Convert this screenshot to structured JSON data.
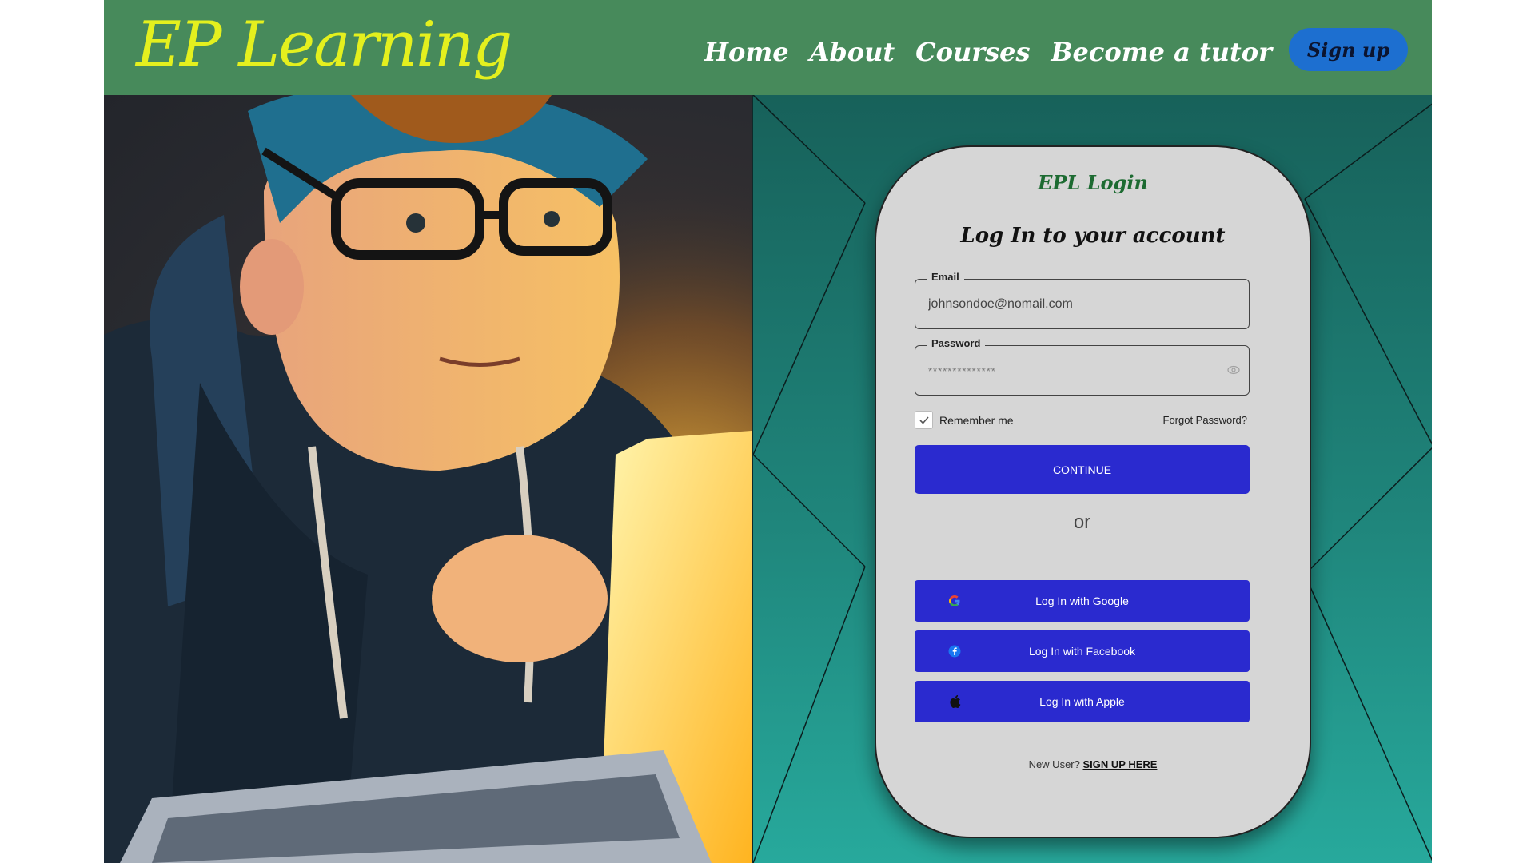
{
  "header": {
    "logo": "EP Learning",
    "nav": [
      "Home",
      "About",
      "Courses",
      "Become a tutor"
    ],
    "signup_label": "Sign up"
  },
  "login": {
    "brand": "EPL Login",
    "title": "Log In to your account",
    "email": {
      "label": "Email",
      "value": "johnsondoe@nomail.com"
    },
    "password": {
      "label": "Password",
      "value": "**************"
    },
    "remember_label": "Remember me",
    "remember_checked": true,
    "forgot_label": "Forgot Password?",
    "continue_label": "CONTINUE",
    "divider_text": "or",
    "social": [
      {
        "label": "Log In with Google",
        "icon": "google-icon"
      },
      {
        "label": "Log In with Facebook",
        "icon": "facebook-icon"
      },
      {
        "label": "Log In with Apple",
        "icon": "apple-icon"
      }
    ],
    "new_user_text": "New User?",
    "signup_link": "SIGN UP HERE"
  },
  "colors": {
    "header_bg": "#478a5b",
    "logo": "#e4f01e",
    "signup_button": "#1d6fd0",
    "primary_button": "#2a2acf",
    "card_bg": "#d6d6d6",
    "brand_green": "#1d6b32",
    "panel_top": "#17615a",
    "panel_bottom": "#27a99c"
  }
}
